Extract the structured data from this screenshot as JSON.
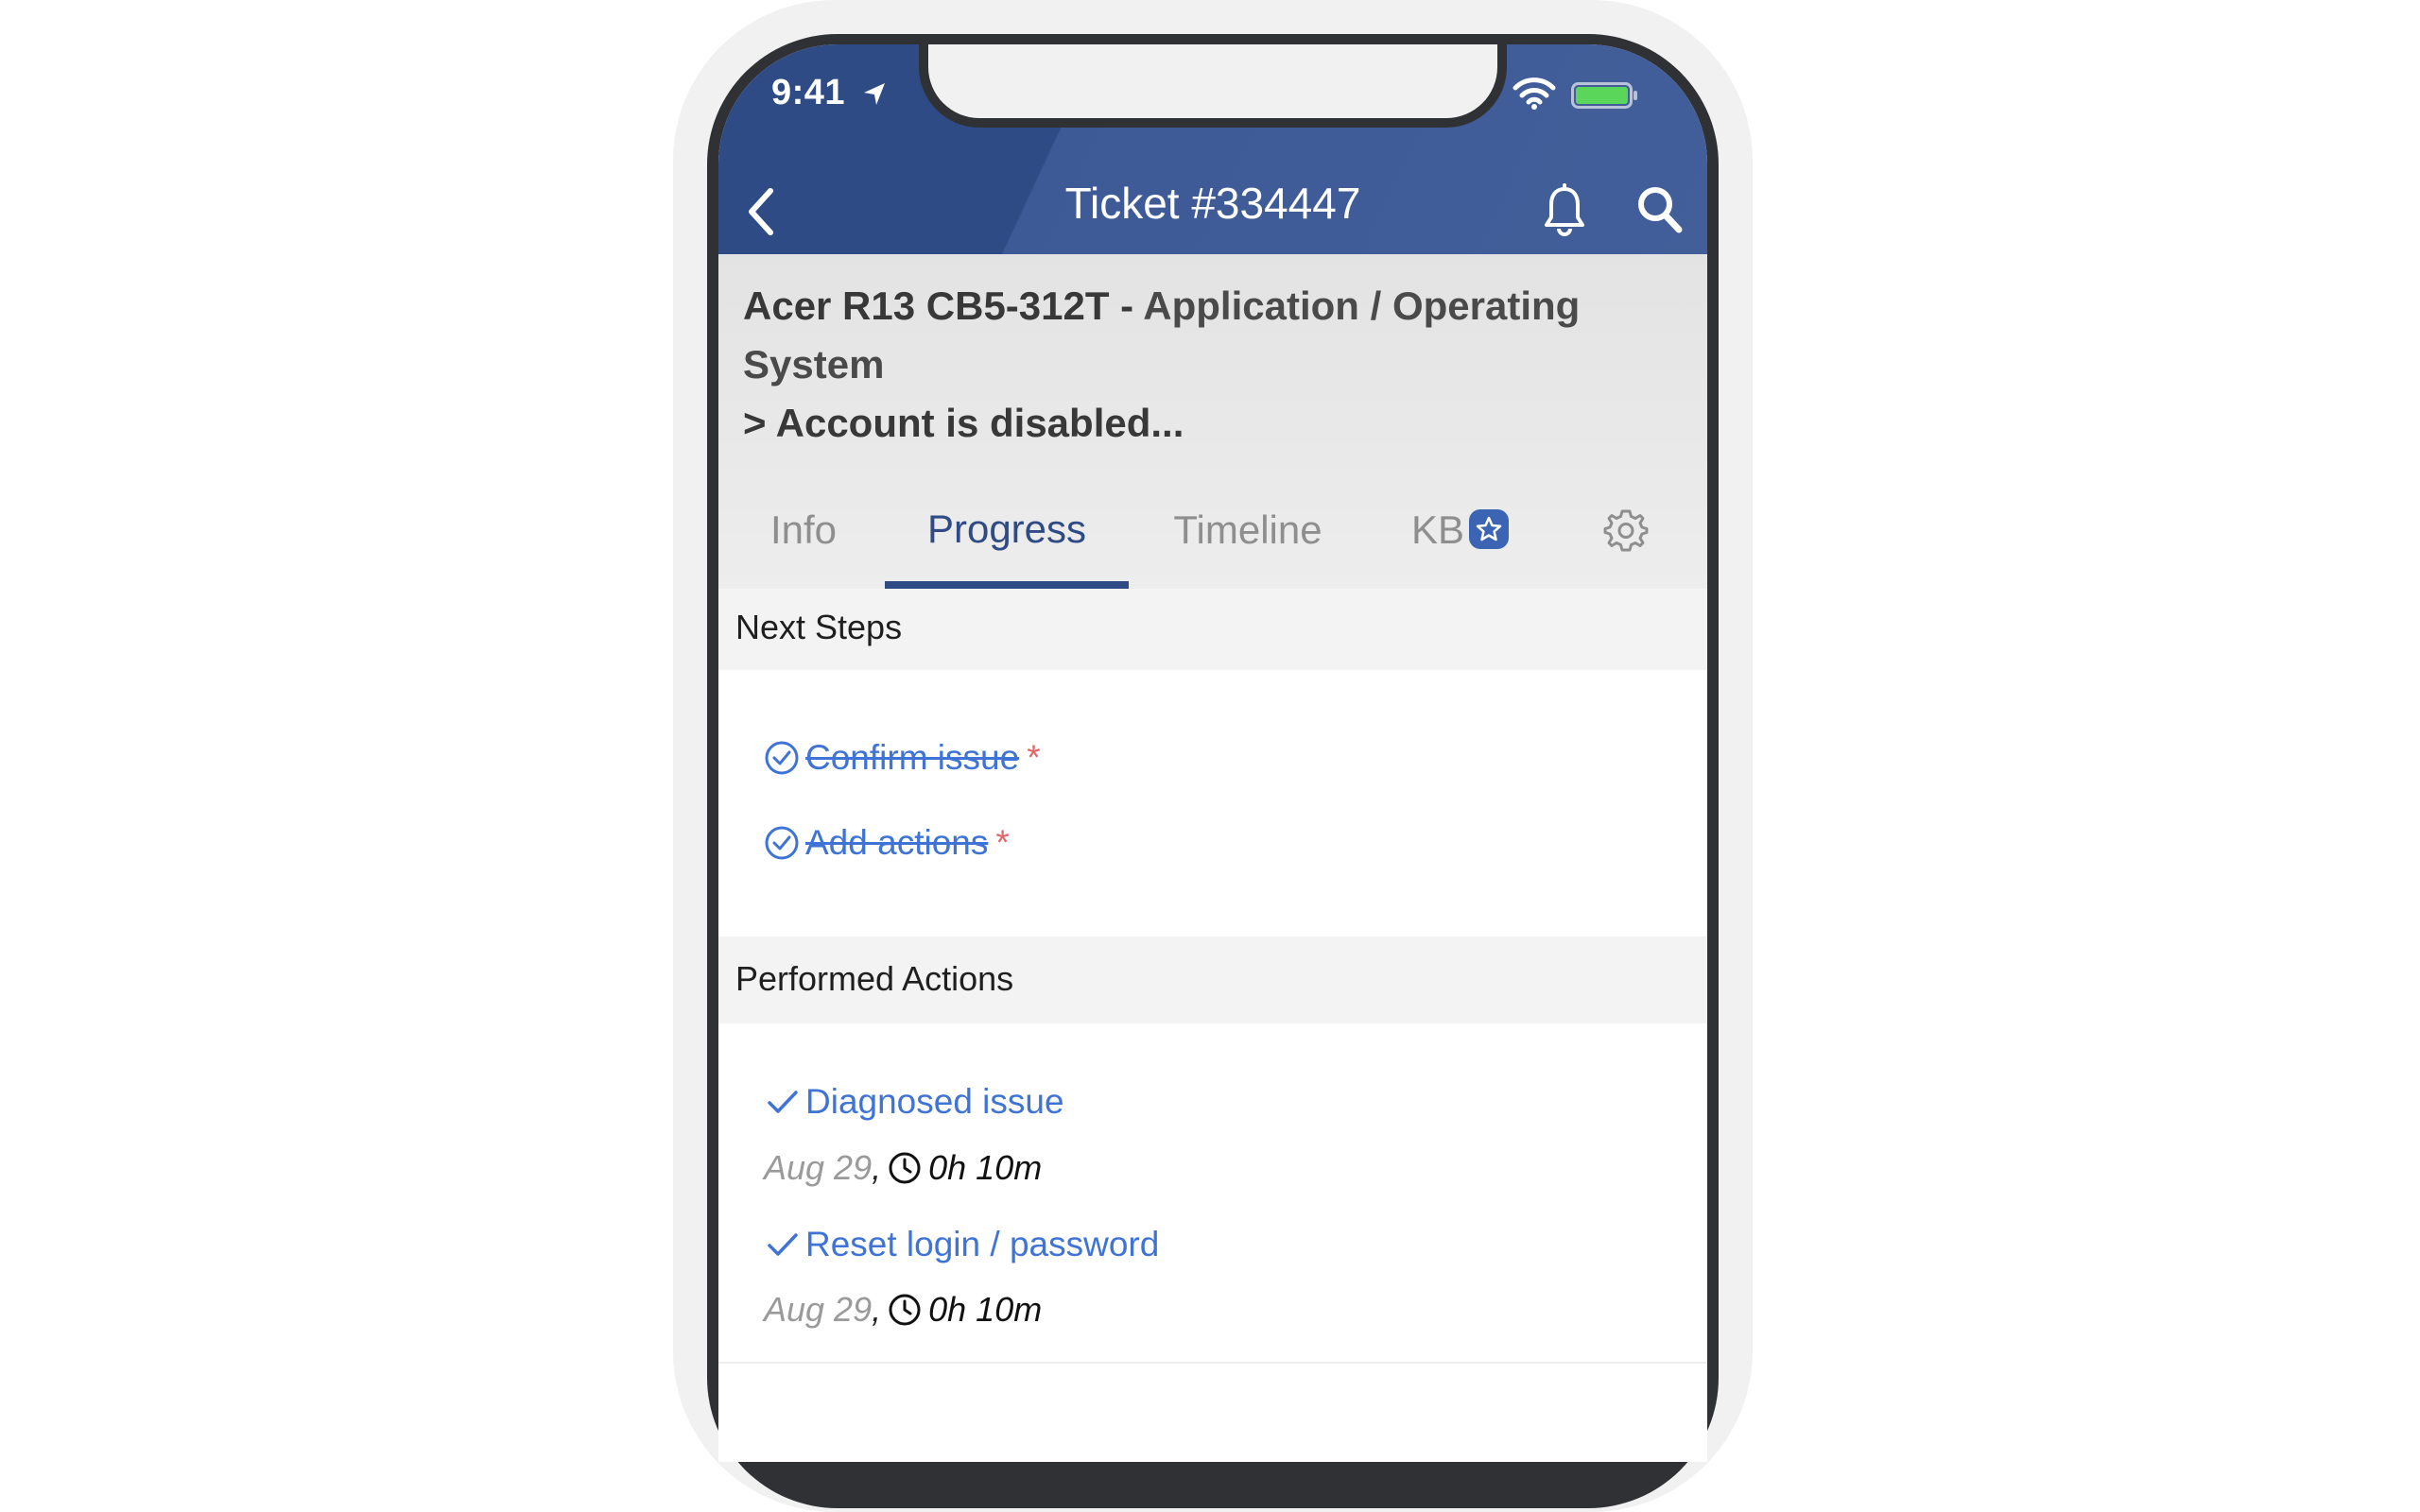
{
  "status_bar": {
    "time": "9:41"
  },
  "header": {
    "title": "Ticket #334447"
  },
  "ticket": {
    "device": "Acer R13 CB5-312T - ",
    "category_line1": "Application / Operating System",
    "category_line2": "> Account is disabled..."
  },
  "tabs": [
    {
      "label": "Info"
    },
    {
      "label": "Progress"
    },
    {
      "label": "Timeline"
    },
    {
      "label": "KB"
    }
  ],
  "next_steps": {
    "title": "Next Steps",
    "items": [
      {
        "label": "Confirm issue",
        "required": "*"
      },
      {
        "label": "Add actions",
        "required": "*"
      }
    ]
  },
  "performed_actions": {
    "title": "Performed Actions",
    "items": [
      {
        "label": "Diagnosed issue",
        "date": "Aug 29",
        "duration": "0h 10m"
      },
      {
        "label": "Reset login / password",
        "date": "Aug 29",
        "duration": "0h 10m"
      }
    ]
  },
  "colors": {
    "header": "#2f4b86",
    "accent": "#3f74d6",
    "required": "#e0666a"
  }
}
